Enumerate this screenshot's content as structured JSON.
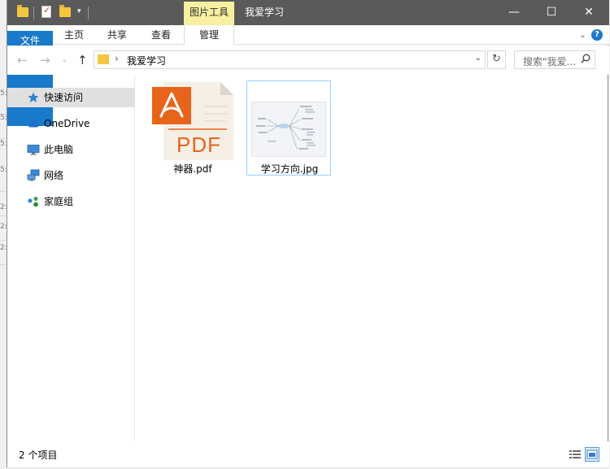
{
  "titlebar": {
    "contextual_tab": "图片工具",
    "title": "我爱学习",
    "minimize": "—",
    "maximize": "☐",
    "close": "✕"
  },
  "ribbon": {
    "tabs": [
      {
        "label": "文件"
      },
      {
        "label": "主页"
      },
      {
        "label": "共享"
      },
      {
        "label": "查看"
      },
      {
        "label": "管理"
      }
    ],
    "expand_chevron": "⌄",
    "help": "?"
  },
  "address": {
    "back": "←",
    "forward": "→",
    "recent": "⌄",
    "up": "↑",
    "separator": "›",
    "path": "我爱学习",
    "dropdown": "⌄",
    "refresh": "↻"
  },
  "search": {
    "placeholder": "搜索\"我爱...",
    "icon": "search-icon"
  },
  "navpane": {
    "items": [
      {
        "label": "快速访问",
        "icon": "star-icon"
      },
      {
        "label": "OneDrive",
        "icon": "cloud-icon"
      },
      {
        "label": "此电脑",
        "icon": "computer-icon"
      },
      {
        "label": "网络",
        "icon": "network-icon"
      },
      {
        "label": "家庭组",
        "icon": "homegroup-icon"
      }
    ]
  },
  "files": [
    {
      "name": "神器.pdf",
      "icon": "pdf-icon",
      "badge": "PDF"
    },
    {
      "name": "学习方向.jpg",
      "icon": "image-thumbnail",
      "selected": true
    }
  ],
  "status": {
    "count": "2 个项目"
  },
  "colors": {
    "accent": "#1979ca",
    "titlebar": "#5a5a5a",
    "contextual": "#f7f0a0",
    "pdf_orange": "#e8641b"
  }
}
